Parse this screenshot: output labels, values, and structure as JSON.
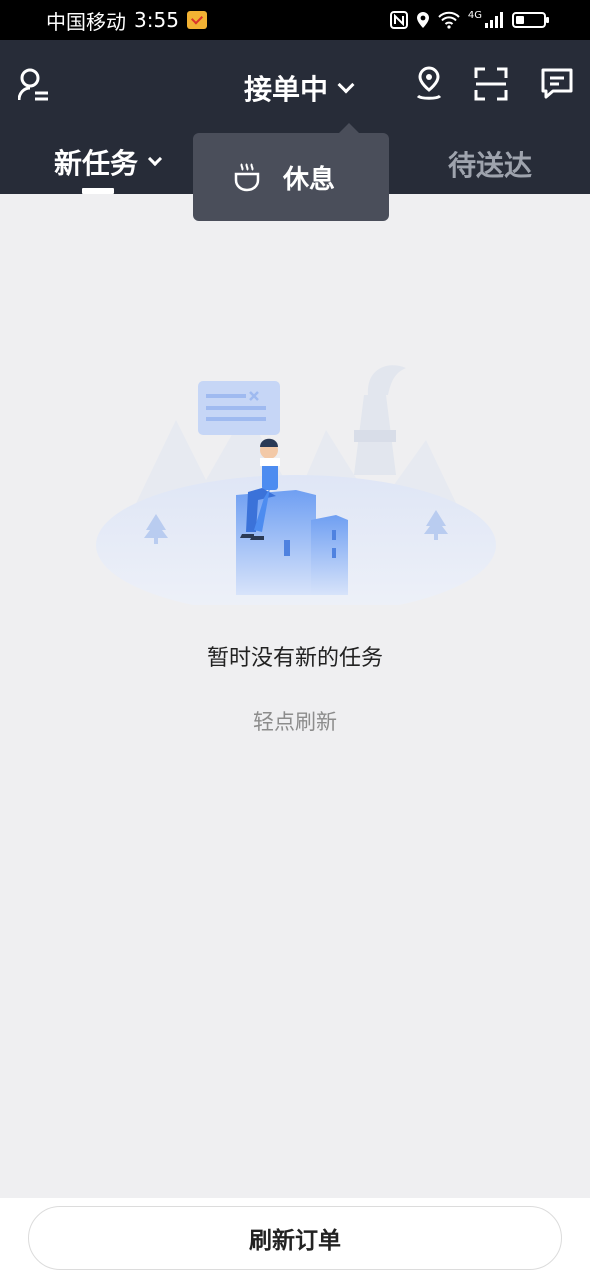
{
  "status_bar": {
    "carrier": "中国移动",
    "time": "3:55",
    "network": "4G"
  },
  "header": {
    "work_status": "接单中",
    "tabs": {
      "new_tasks": "新任务",
      "to_deliver": "待送达"
    }
  },
  "dropdown": {
    "rest_label": "休息"
  },
  "empty_state": {
    "title": "暂时没有新的任务",
    "refresh_hint": "轻点刷新"
  },
  "bottom": {
    "refresh_orders": "刷新订单"
  },
  "colors": {
    "header_bg": "#272c38",
    "page_bg": "#efeff1",
    "dropdown_bg": "#4a4e5a",
    "illustration_blue": "#4d8cf0"
  },
  "icons": [
    "profile-icon",
    "chevron-down-icon",
    "location-icon",
    "scan-icon",
    "message-icon",
    "coffee-cup-icon"
  ]
}
